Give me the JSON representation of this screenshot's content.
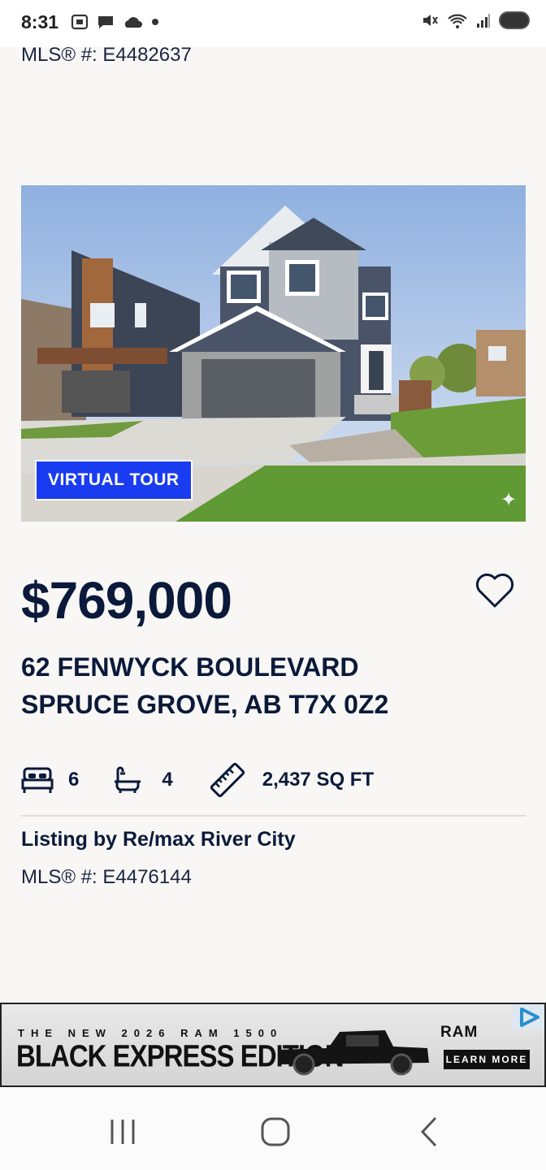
{
  "status_bar": {
    "time": "8:31"
  },
  "listing_top": {
    "mls": "MLS® #: E4482637"
  },
  "photo": {
    "virtual_tour_label": "VIRTUAL TOUR"
  },
  "listing": {
    "price": "$769,000",
    "address_line1": "62 FENWYCK BOULEVARD",
    "address_line2": "SPRUCE GROVE, AB T7X 0Z2",
    "beds": "6",
    "baths": "4",
    "area": "2,437 SQ FT",
    "listing_by": "Listing by Re/max River City",
    "mls": "MLS® #: E4476144"
  },
  "ad": {
    "line_small": "THE NEW 2026 RAM 1500",
    "line_big": "BLACK EXPRESS EDITION",
    "brand": "RAM",
    "cta": "LEARN MORE"
  },
  "colors": {
    "navy": "#0b1a3a",
    "tour_blue": "#1a3cf0",
    "background": "#f8f7f5"
  }
}
